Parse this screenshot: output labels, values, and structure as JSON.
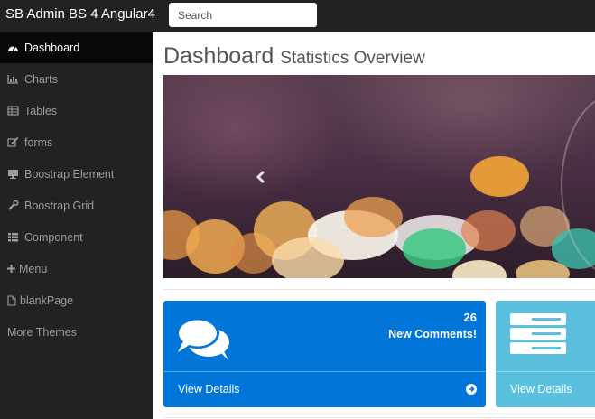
{
  "navbar": {
    "brand": "SB Admin BS 4 Angular4",
    "search_placeholder": "Search"
  },
  "sidebar": {
    "items": [
      {
        "label": "Dashboard",
        "icon": "dashboard-icon",
        "active": true
      },
      {
        "label": "Charts",
        "icon": "bar-chart-icon"
      },
      {
        "label": "Tables",
        "icon": "table-icon"
      },
      {
        "label": "forms",
        "icon": "edit-icon"
      },
      {
        "label": "Boostrap Element",
        "icon": "desktop-icon"
      },
      {
        "label": "Boostrap Grid",
        "icon": "wrench-icon"
      },
      {
        "label": "Component",
        "icon": "list-icon"
      },
      {
        "label": "Menu",
        "icon": "plus-icon"
      },
      {
        "label": "blankPage",
        "icon": "file-icon"
      },
      {
        "label": "More Themes",
        "icon": ""
      }
    ]
  },
  "main": {
    "title": "Dashboard",
    "subtitle": "Statistics Overview",
    "panels": [
      {
        "count": "26",
        "label": "New Comments!",
        "footer": "View Details",
        "color": "#0275d8",
        "icon": "comments-icon"
      },
      {
        "count": "",
        "label": "",
        "footer": "View Details",
        "color": "#5bc0de",
        "icon": "tasks-icon"
      }
    ]
  },
  "colors": {
    "navbar": "#222222",
    "sidebar_active": "#080808",
    "primary": "#0275d8",
    "info": "#5bc0de"
  }
}
